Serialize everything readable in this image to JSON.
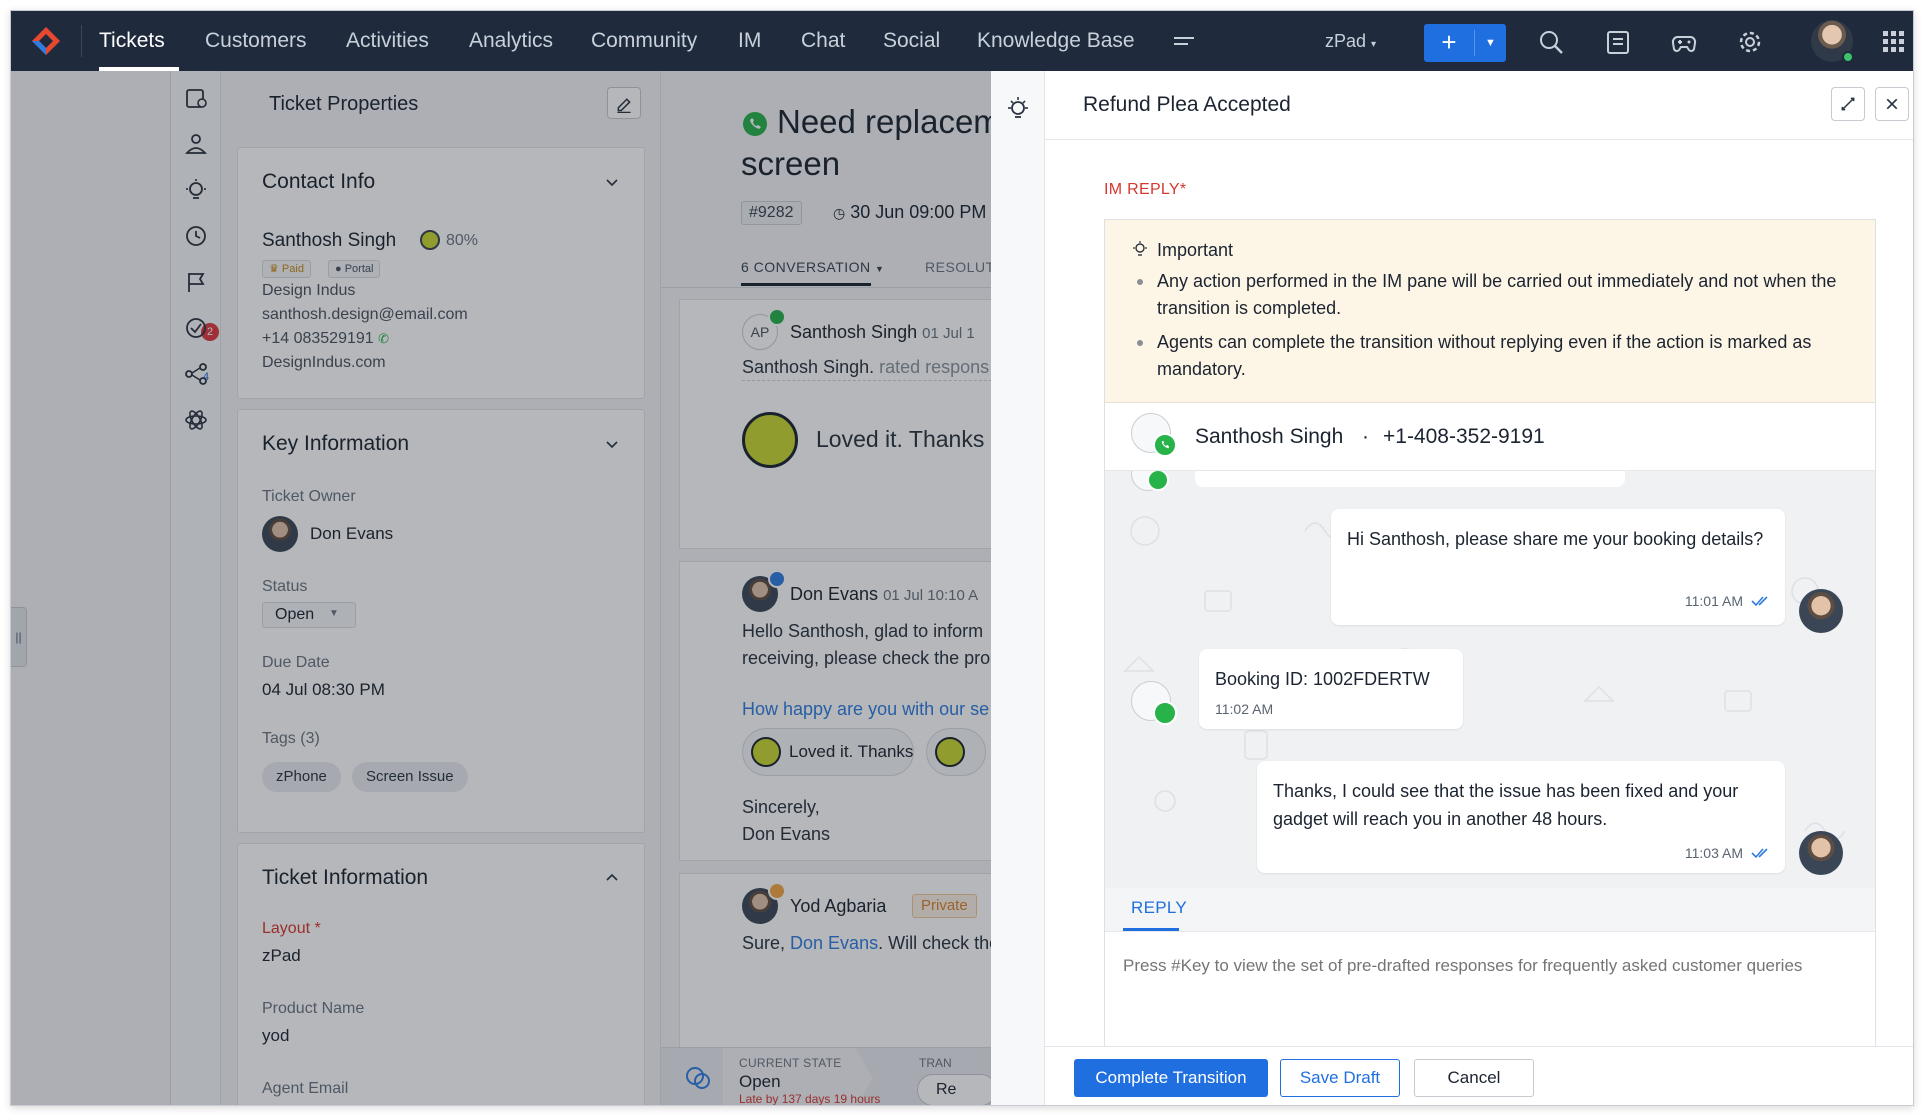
{
  "topnav": {
    "tabs": [
      "Tickets",
      "Customers",
      "Activities",
      "Analytics",
      "Community",
      "IM",
      "Chat",
      "Social",
      "Knowledge Base"
    ],
    "department": "zPad"
  },
  "properties": {
    "title": "Ticket Properties",
    "contact": {
      "heading": "Contact Info",
      "name": "Santhosh Singh",
      "happiness": "80%",
      "badge_paid": "Paid",
      "badge_portal": "Portal",
      "company": "Design Indus",
      "email": "santhosh.design@email.com",
      "phone": "+14 083529191",
      "website": "DesignIndus.com"
    },
    "key_info": {
      "heading": "Key Information",
      "owner_label": "Ticket Owner",
      "owner": "Don Evans",
      "status_label": "Status",
      "status": "Open",
      "due_label": "Due Date",
      "due": "04 Jul 08:30 PM",
      "tags_label": "Tags (3)",
      "tags": [
        "zPhone",
        "Screen Issue"
      ]
    },
    "ticket_info": {
      "heading": "Ticket Information",
      "layout_label": "Layout *",
      "layout": "zPad",
      "product_label": "Product Name",
      "product": "yod",
      "agent_email_label": "Agent Email"
    }
  },
  "rail": {
    "badge_count": "2",
    "sup_count": "4"
  },
  "conversation": {
    "title_line1": "Need replacem",
    "title_line2": "screen",
    "ticket_id": "#9282",
    "date": "30 Jun 09:00 PM",
    "tab_conversation": "6 CONVERSATION",
    "tab_resolution": "RESOLUTI",
    "thread1": {
      "initials": "AP",
      "name": "Santhosh Singh",
      "time": "01 Jul 1",
      "text": "Santhosh Singh.",
      "text_muted": " rated respons",
      "feedback": "Loved it. Thanks"
    },
    "thread2": {
      "name": "Don Evans",
      "time": "01 Jul 10:10 A",
      "line1": "Hello Santhosh, glad to inform",
      "line2": "receiving, please check the pro",
      "survey": "How happy are you with our se",
      "feedback": "Loved it. Thanks",
      "sign1": "Sincerely,",
      "sign2": "Don Evans"
    },
    "thread3": {
      "name": "Yod Agbaria",
      "private": "Private",
      "text_pre": "Sure, ",
      "mention": "Don Evans",
      "text_post": ". Will check the"
    },
    "state": {
      "label": "CURRENT STATE",
      "value": "Open",
      "late": "Late by 137 days 19 hours",
      "trans_label": "TRAN",
      "trans_btn": "Re"
    }
  },
  "panel": {
    "title": "Refund Plea Accepted",
    "im_label": "IM REPLY*",
    "notice": {
      "title": "Important",
      "items": [
        "Any action performed in the IM pane will be carried out immediately and not when the transition is completed.",
        "Agents can complete the transition without replying even if the action is marked as mandatory."
      ]
    },
    "chat": {
      "name": "Santhosh Singh",
      "separator": "·",
      "phone": "+1-408-352-9191",
      "messages": [
        {
          "from": "agent",
          "text": "Hi Santhosh, please share me your booking details?",
          "time": "11:01 AM"
        },
        {
          "from": "customer",
          "text": "Booking ID: 1002FDERTW",
          "time": "11:02 AM"
        },
        {
          "from": "agent",
          "text": "Thanks, I could see that the issue has been fixed and your gadget will reach you in another 48 hours.",
          "time": "11:03 AM"
        }
      ]
    },
    "reply_tab": "REPLY",
    "reply_placeholder": "Press #Key to view the set of pre-drafted responses for frequently asked customer queries",
    "buttons": {
      "complete": "Complete Transition",
      "draft": "Save Draft",
      "cancel": "Cancel"
    }
  },
  "colors": {
    "accent": "#1f6fe0",
    "nav_bg": "#1f2a3c",
    "required": "#d7372f",
    "notice_bg": "#fdf5e6",
    "whatsapp": "#27b24a"
  }
}
